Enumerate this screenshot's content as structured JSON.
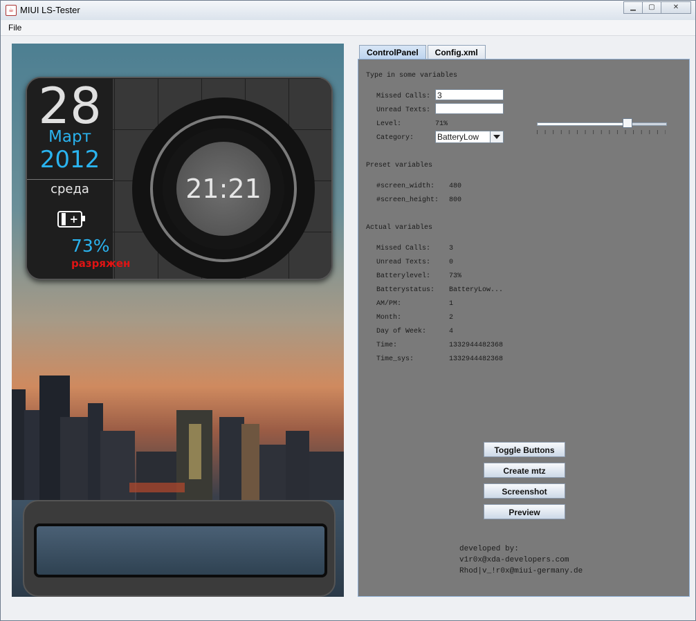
{
  "window": {
    "title": "MIUI LS-Tester",
    "controls": {
      "minimize": "▁",
      "maximize": "▢",
      "close": "✕"
    }
  },
  "menu": {
    "items": [
      "File"
    ]
  },
  "lockscreen": {
    "day": "28",
    "month": "Март",
    "year": "2012",
    "weekday": "среда",
    "battery_percent": "73%",
    "battery_status": "разряжен",
    "time": "21:21"
  },
  "tabs": [
    {
      "label": "ControlPanel",
      "active": true
    },
    {
      "label": "Config.xml",
      "active": false
    }
  ],
  "control_panel": {
    "section_type_in": "Type in some variables",
    "missed_calls_label": "Missed Calls:",
    "missed_calls_value": "3",
    "unread_texts_label": "Unread Texts:",
    "unread_texts_value": "",
    "level_label": "Level:",
    "level_value": "71%",
    "level_fraction": 0.71,
    "category_label": "Category:",
    "category_value": "BatteryLow",
    "section_preset": "Preset variables",
    "screen_width_label": "#screen_width:",
    "screen_width_value": "480",
    "screen_height_label": "#screen_height:",
    "screen_height_value": "800",
    "section_actual": "Actual variables",
    "actual": [
      {
        "label": "Missed Calls:",
        "value": "3"
      },
      {
        "label": "Unread Texts:",
        "value": "0"
      },
      {
        "label": "Batterylevel:",
        "value": "73%"
      },
      {
        "label": "Batterystatus:",
        "value": "BatteryLow..."
      },
      {
        "label": "AM/PM:",
        "value": "1"
      },
      {
        "label": "Month:",
        "value": "2"
      },
      {
        "label": "Day of Week:",
        "value": "4"
      },
      {
        "label": "Time:",
        "value": "1332944482368"
      },
      {
        "label": "Time_sys:",
        "value": "1332944482368"
      }
    ],
    "buttons": [
      "Toggle Buttons",
      "Create mtz",
      "Screenshot",
      "Preview"
    ],
    "credits": [
      "developed by:",
      "v1r0x@xda-developers.com",
      "Rhod|v_!r0x@miui-germany.de"
    ]
  },
  "colors": {
    "accent_blue": "#2ab3ef",
    "status_red": "#e01414",
    "panel_bg": "#7a7a7a"
  }
}
